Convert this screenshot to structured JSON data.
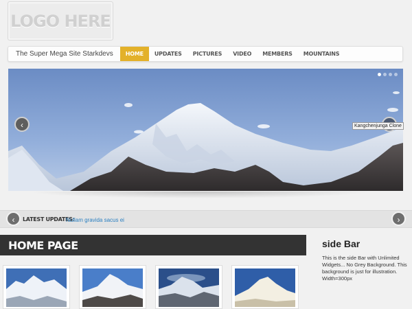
{
  "logo": {
    "text": "LOGO HERE"
  },
  "header": {
    "site_title": "The Super Mega Site Starkdevs",
    "nav": [
      {
        "label": "HOME",
        "active": true
      },
      {
        "label": "UPDATES",
        "active": false
      },
      {
        "label": "PICTURES",
        "active": false
      },
      {
        "label": "VIDEO",
        "active": false
      },
      {
        "label": "MEMBERS",
        "active": false
      },
      {
        "label": "MOUNTAINS",
        "active": false
      }
    ]
  },
  "slider": {
    "caption": "Kangchenjunga Clone",
    "prev_icon": "‹",
    "next_icon": "›",
    "slide_count": 4,
    "current_slide": 1
  },
  "updates": {
    "label": "LATEST UPDATES:",
    "link": "Nullam gravida sacus ei",
    "prev_icon": "‹",
    "next_icon": "›"
  },
  "main": {
    "title": "HOME PAGE"
  },
  "sidebar": {
    "title": "side Bar",
    "text": "This is the side Bar with Unlimited Widgets... No Grey Background. This background is just for illustration. Width=300px"
  },
  "colors": {
    "accent": "#e3b12a",
    "dark_bar": "#333333",
    "link": "#2a7fc1"
  }
}
